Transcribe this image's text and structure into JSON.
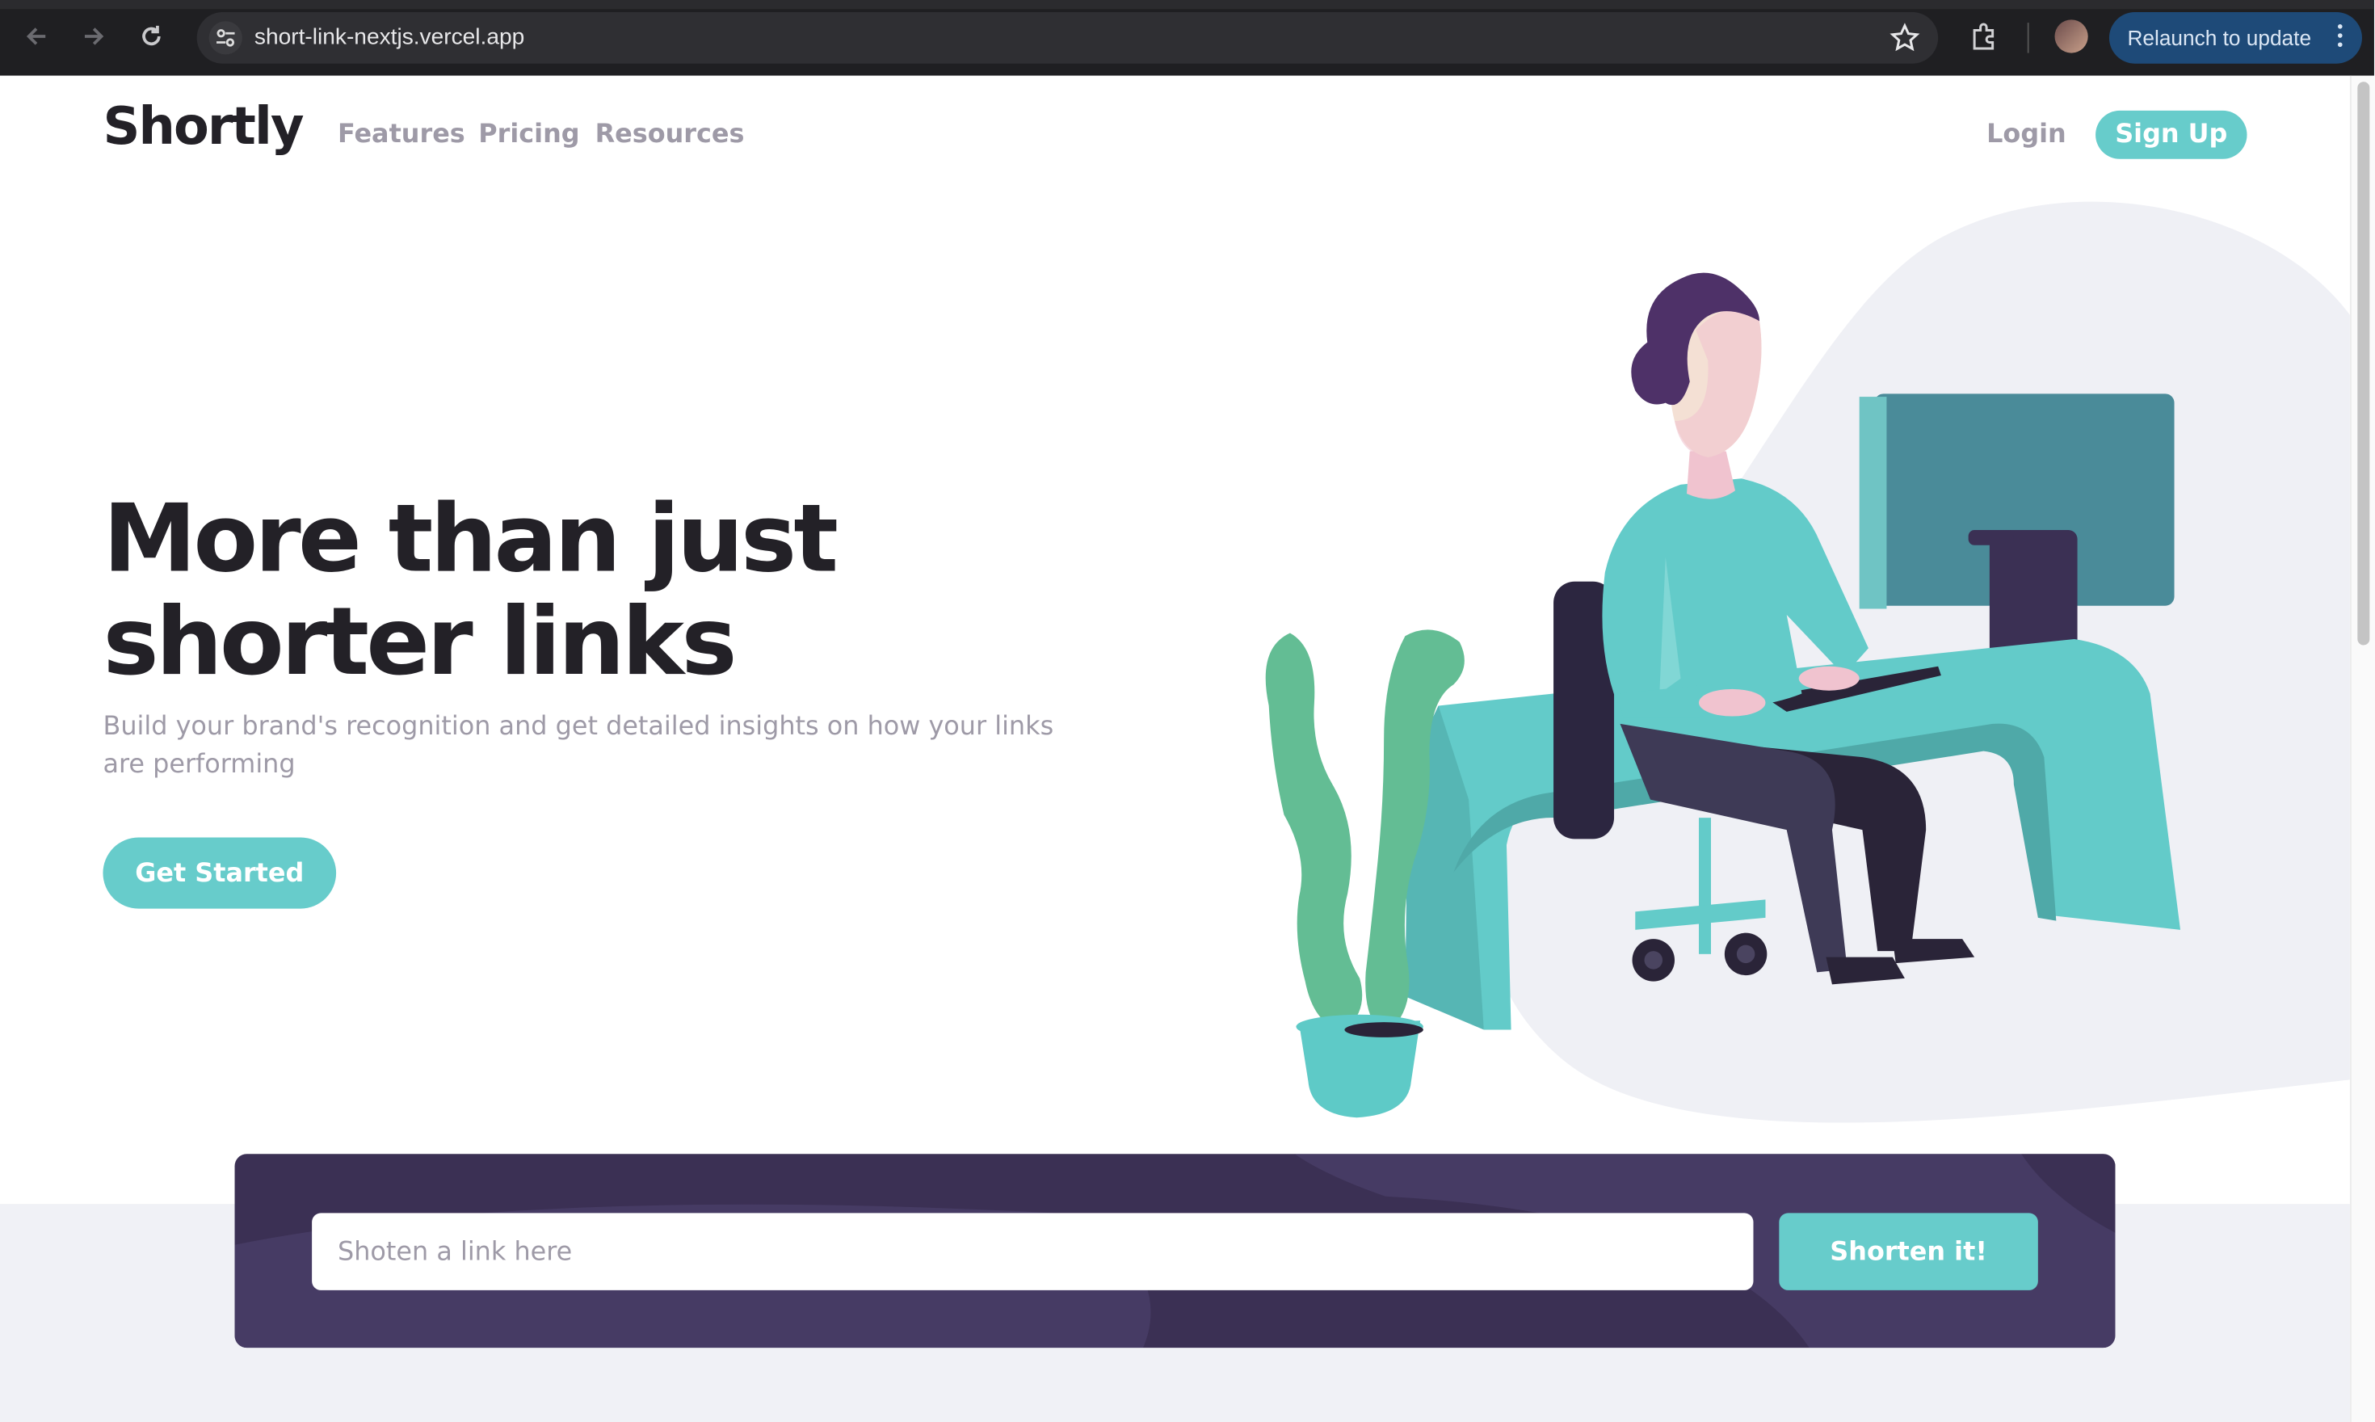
{
  "browser": {
    "url": "short-link-nextjs.vercel.app",
    "relaunch_label": "Relaunch to update"
  },
  "header": {
    "logo": "Shortly",
    "nav": [
      "Features",
      "Pricing",
      "Resources"
    ],
    "login": "Login",
    "signup": "Sign Up"
  },
  "hero": {
    "title_line1": "More than just",
    "title_line2": "shorter links",
    "subtitle": "Build your brand's recognition and get detailed insights on how your links are performing",
    "cta": "Get Started"
  },
  "shorten": {
    "placeholder": "Shoten a link here",
    "button": "Shorten it!"
  },
  "colors": {
    "accent": "#67cccb",
    "dark_violet": "#3b3054",
    "heading": "#232127",
    "muted_text": "#9e9aa7",
    "chrome_bg": "#1f1f22",
    "relaunch_bg": "#1e4a78"
  },
  "icons": [
    "back-arrow-icon",
    "forward-arrow-icon",
    "reload-icon",
    "site-settings-icon",
    "bookmark-star-icon",
    "extensions-icon",
    "profile-avatar",
    "more-menu-icon"
  ]
}
